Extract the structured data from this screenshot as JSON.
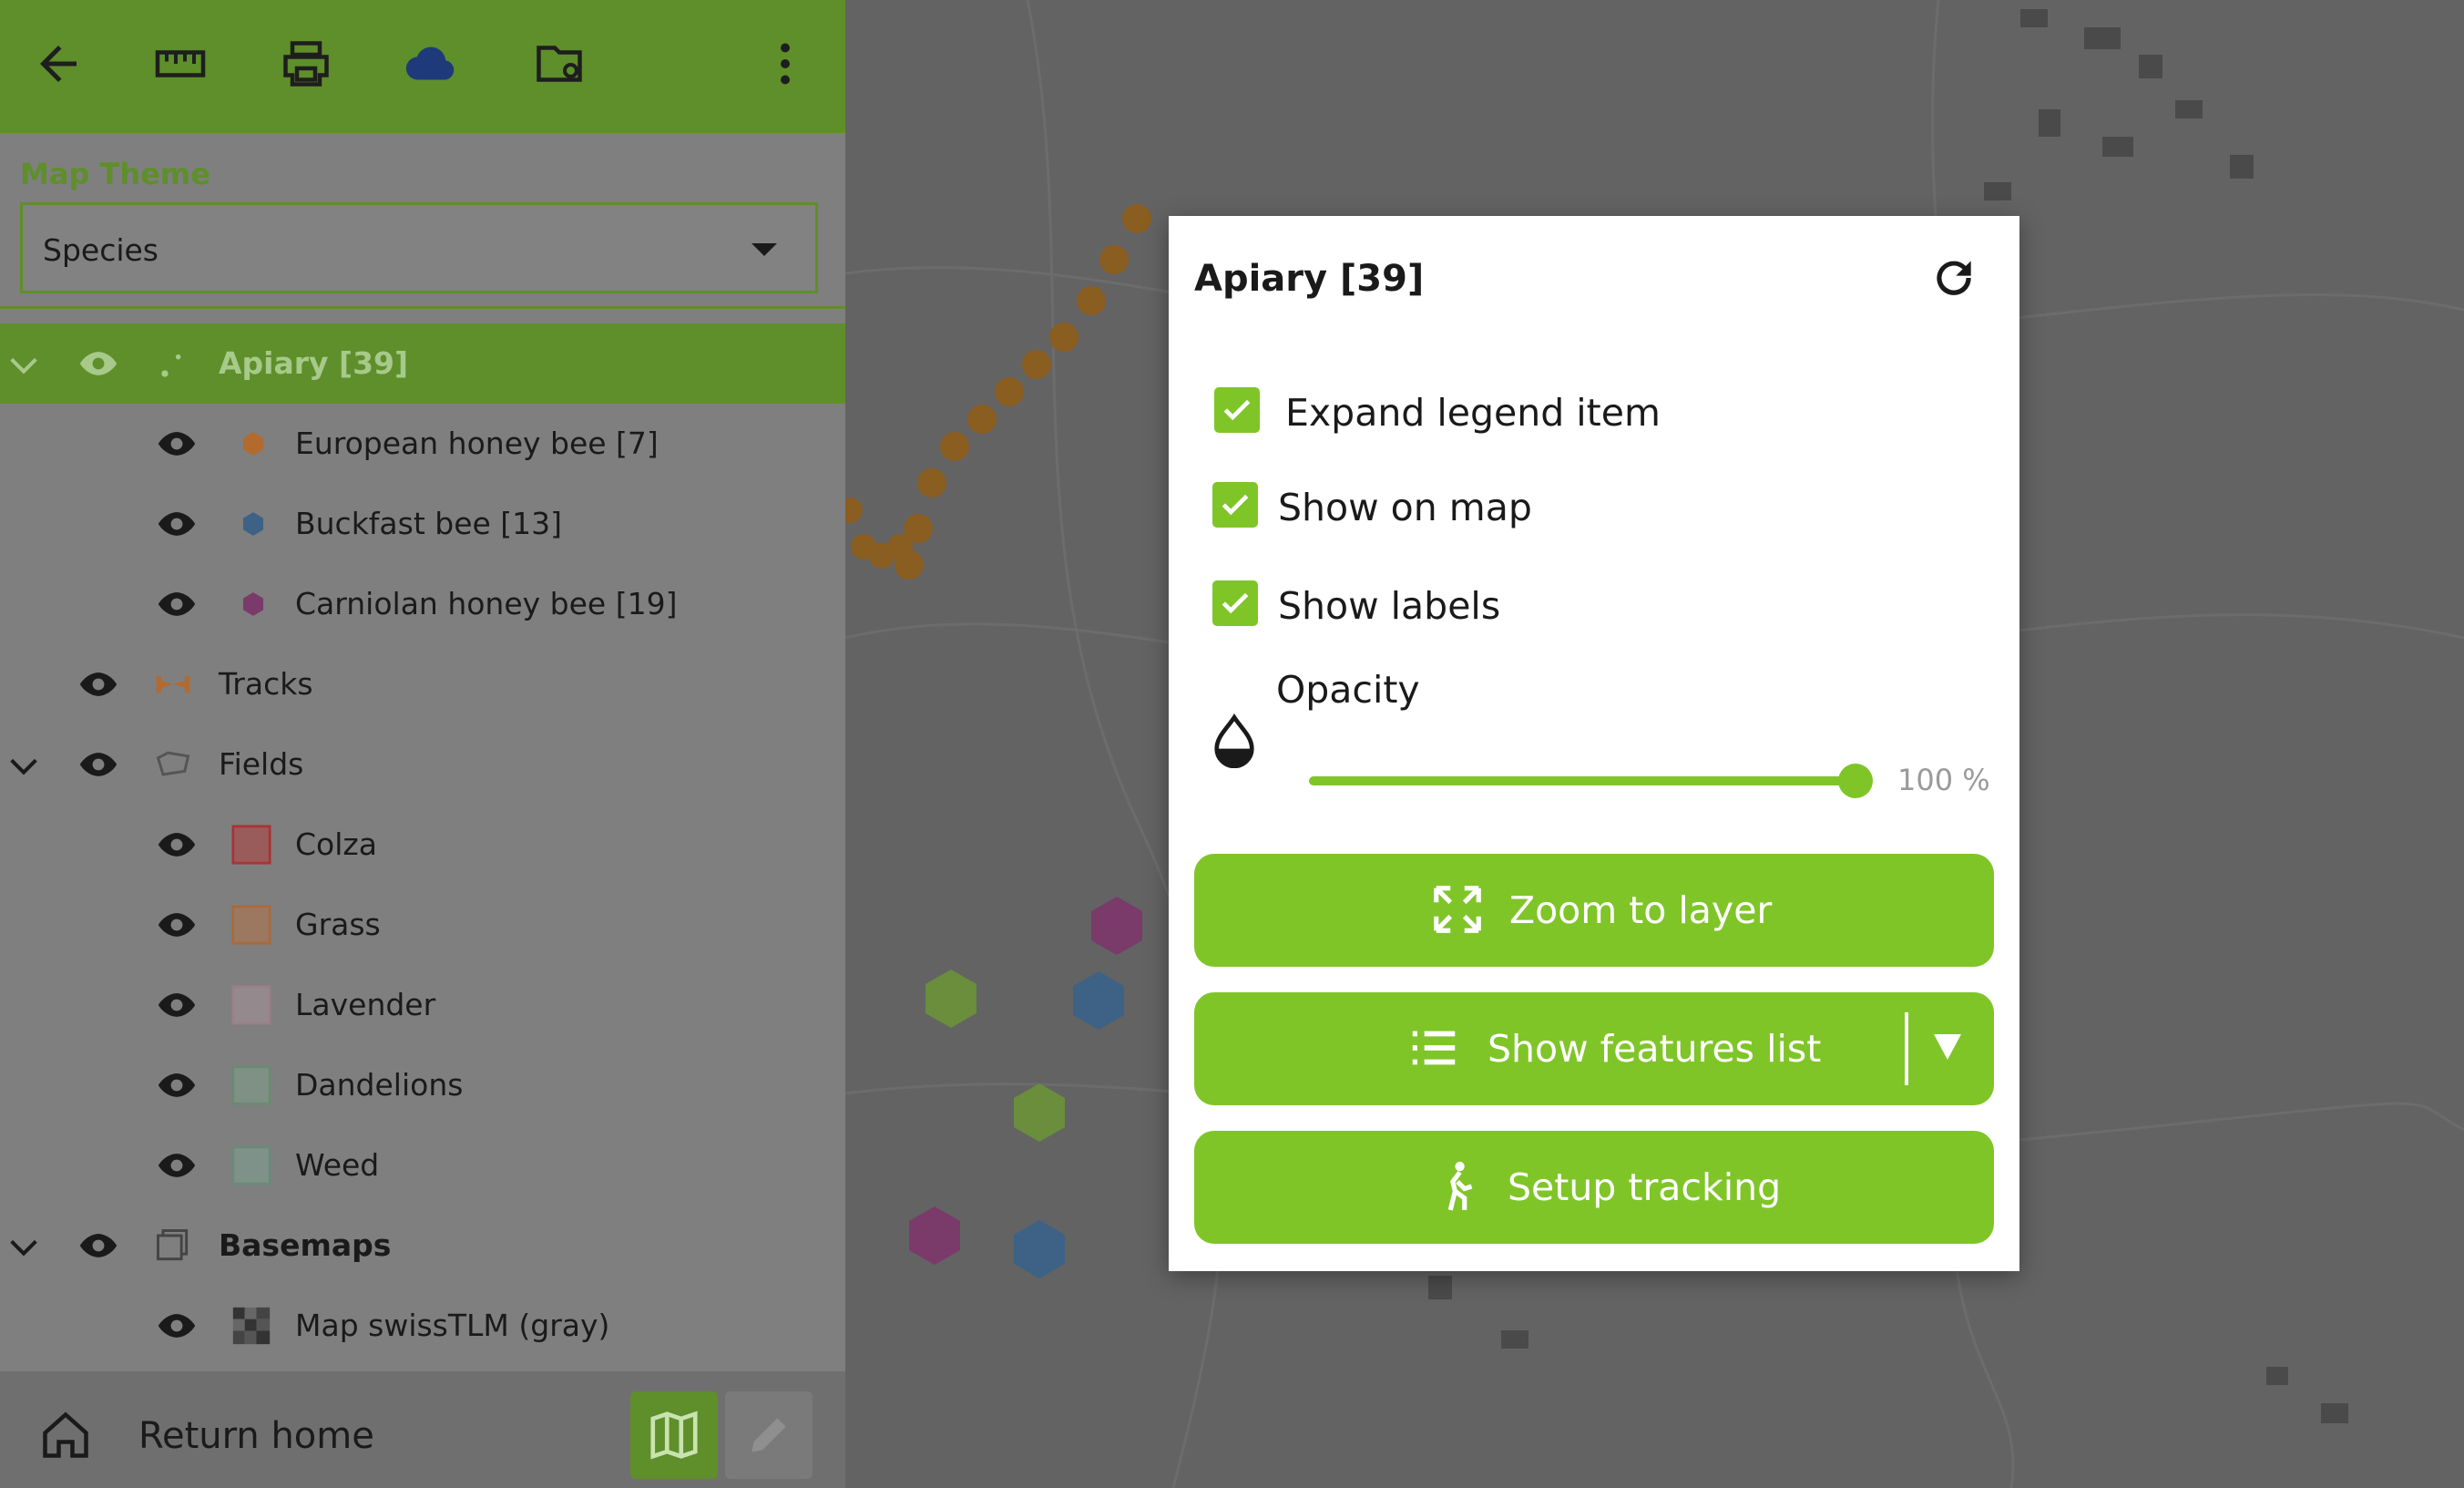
{
  "colors": {
    "accent": "#7fc528",
    "toolbar": "#5e8f2a",
    "map_dim": "#636363"
  },
  "toolbar": {
    "icons": [
      "back-arrow-icon",
      "ruler-icon",
      "printer-icon",
      "cloud-icon",
      "folder-settings-icon",
      "more-vert-icon"
    ]
  },
  "map_theme": {
    "label": "Map Theme",
    "value": "Species"
  },
  "legend": {
    "apiary": "Apiary [39]",
    "european": "European honey bee [7]",
    "buckfast": "Buckfast bee [13]",
    "carniolan": "Carniolan honey bee [19]",
    "tracks": "Tracks",
    "fields": "Fields",
    "colza": "Colza",
    "grass": "Grass",
    "lavender": "Lavender",
    "dandelions": "Dandelions",
    "weed": "Weed",
    "basemaps": "Basemaps",
    "swisstlm": "Map swissTLM (gray)"
  },
  "bottom": {
    "return_home": "Return home"
  },
  "dialog": {
    "title": "Apiary [39]",
    "expand_legend": "Expand legend item",
    "show_on_map": "Show on map",
    "show_labels": "Show labels",
    "opacity_label": "Opacity",
    "opacity_value": "100 %",
    "opacity": 1.0,
    "zoom_to_layer": "Zoom to layer",
    "show_features_list": "Show features list",
    "setup_tracking": "Setup tracking",
    "checks": {
      "expand_legend": true,
      "show_on_map": true,
      "show_labels": true
    }
  }
}
